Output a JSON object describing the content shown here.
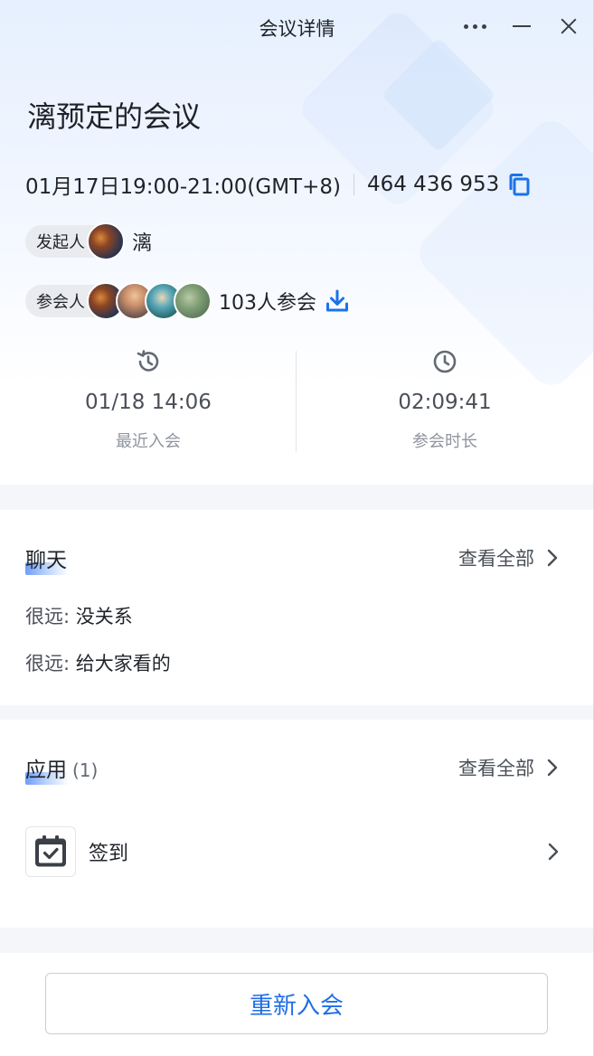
{
  "window": {
    "title": "会议详情"
  },
  "meeting": {
    "title": "漓预定的会议",
    "time": "01月17日19:00-21:00(GMT+8)",
    "id": "464 436 953"
  },
  "initiator": {
    "label": "发起人",
    "name": "漓"
  },
  "participants": {
    "label": "参会人",
    "count_text": "103人参会"
  },
  "stats": {
    "last_join": {
      "value": "01/18 14:06",
      "label": "最近入会"
    },
    "duration": {
      "value": "02:09:41",
      "label": "参会时长"
    }
  },
  "chat": {
    "title": "聊天",
    "view_all": "查看全部",
    "messages": [
      {
        "sender": "很远:",
        "text": " 没关系"
      },
      {
        "sender": "很远:",
        "text": " 给大家看的"
      }
    ]
  },
  "apps": {
    "title": "应用",
    "count": "(1)",
    "view_all": "查看全部",
    "items": [
      {
        "name": "签到",
        "icon": "calendar-check-icon"
      }
    ]
  },
  "actions": {
    "rejoin": "重新入会"
  },
  "colors": {
    "accent": "#1f6ee8",
    "icon_blue": "#1a73e8"
  }
}
